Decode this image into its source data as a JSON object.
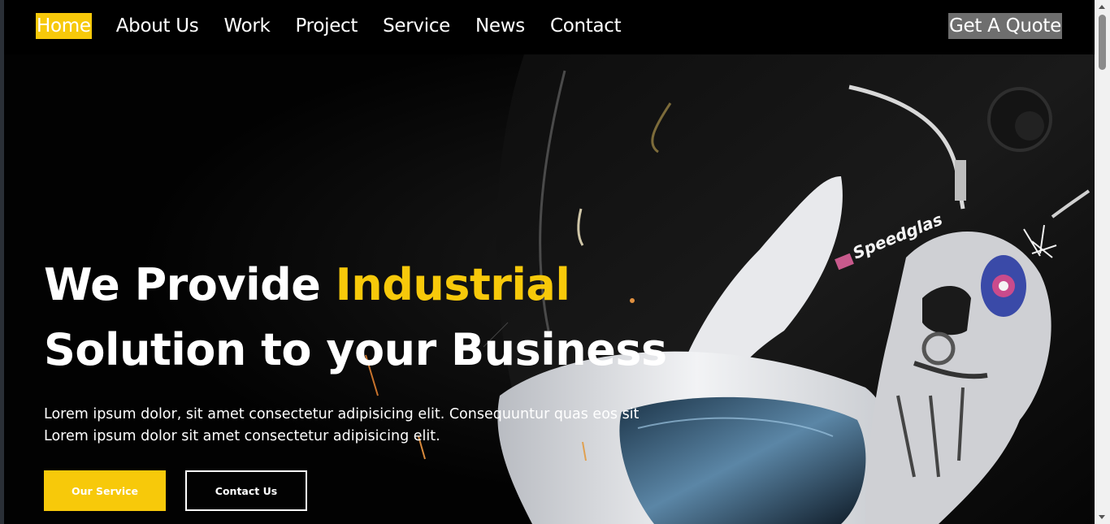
{
  "nav": {
    "items": [
      {
        "label": "Home",
        "active": true
      },
      {
        "label": "About Us",
        "active": false
      },
      {
        "label": "Work",
        "active": false
      },
      {
        "label": "Project",
        "active": false
      },
      {
        "label": "Service",
        "active": false
      },
      {
        "label": "News",
        "active": false
      },
      {
        "label": "Contact",
        "active": false
      }
    ],
    "quote_label": "Get A Quote"
  },
  "hero": {
    "title_part1": "We Provide ",
    "title_highlight": "Industrial",
    "title_line2": "Solution to your Business",
    "paragraph_line1": "Lorem ipsum dolor, sit amet consectetur adipisicing elit. Consequuntur quas eos sit",
    "paragraph_line2": "Lorem ipsum dolor sit amet consectetur adipisicing elit.",
    "primary_button": "Our Service",
    "secondary_button": "Contact Us",
    "image_brand_text": "Speedglas"
  },
  "theme": {
    "accent": "#f7c90a",
    "background": "#000000",
    "quote_button_bg": "#6e6e6e"
  }
}
